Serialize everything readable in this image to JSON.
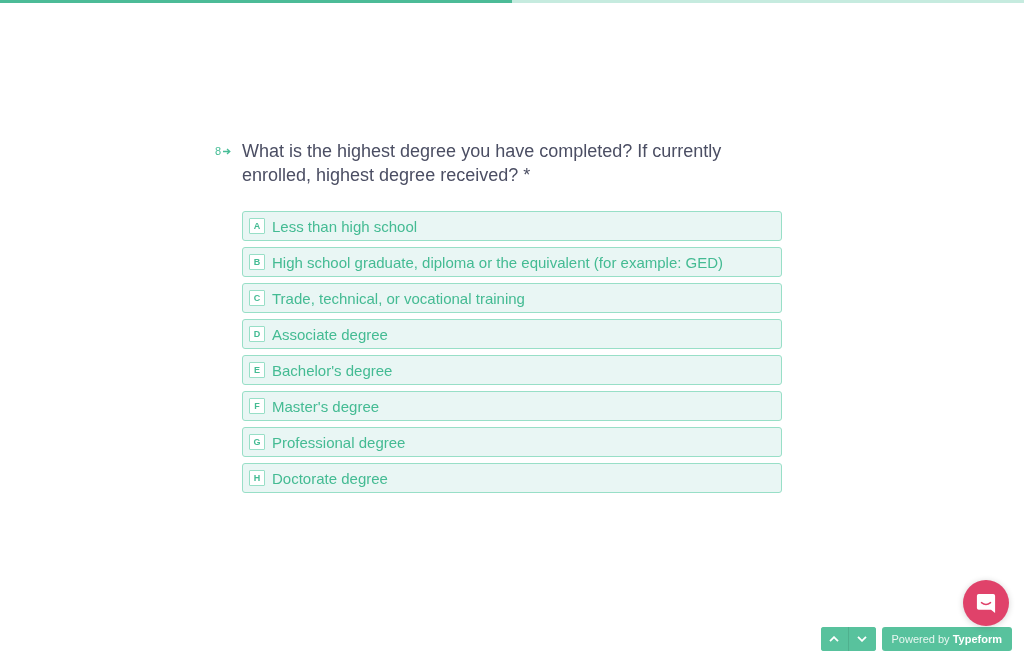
{
  "progress": {
    "level": 0.5
  },
  "question": {
    "number": "8",
    "text": "What is the highest degree you have completed? If currently enrolled, highest degree received? *"
  },
  "options": [
    {
      "key": "A",
      "label": "Less than high school",
      "selected": false
    },
    {
      "key": "B",
      "label": "High school graduate, diploma or the equivalent (for example: GED)",
      "selected": false
    },
    {
      "key": "C",
      "label": "Trade, technical, or vocational training",
      "selected": false
    },
    {
      "key": "D",
      "label": "Associate degree",
      "selected": false
    },
    {
      "key": "E",
      "label": "Bachelor's degree",
      "selected": false
    },
    {
      "key": "F",
      "label": "Master's degree",
      "selected": false
    },
    {
      "key": "G",
      "label": "Professional degree",
      "selected": false
    },
    {
      "key": "H",
      "label": "Doctorate degree",
      "selected": false
    }
  ],
  "branding": "Powered by **Typeform**"
}
